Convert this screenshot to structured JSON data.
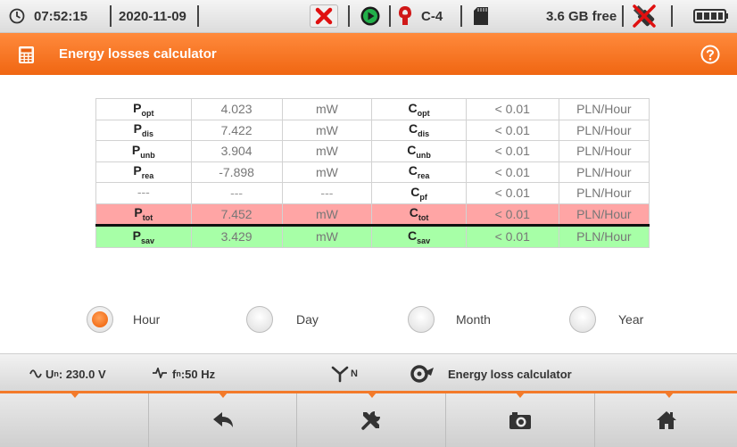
{
  "status": {
    "time": "07:52:15",
    "date": "2020-11-09",
    "clamp": "C-4",
    "storage": "3.6 GB free",
    "icons": [
      "clock-icon",
      "error-x-icon",
      "record-icon",
      "clamp-icon",
      "sd-card-icon",
      "usb-icon",
      "battery-icon"
    ]
  },
  "header": {
    "title": "Energy losses calculator",
    "icon": "calculator-icon",
    "help_icon": "help-icon"
  },
  "table": {
    "rows": [
      {
        "p_label": "P",
        "p_sub": "opt",
        "p_value": "4.023",
        "p_unit": "mW",
        "c_label": "C",
        "c_sub": "opt",
        "c_value": "< 0.01",
        "c_unit": "PLN/Hour"
      },
      {
        "p_label": "P",
        "p_sub": "dis",
        "p_value": "7.422",
        "p_unit": "mW",
        "c_label": "C",
        "c_sub": "dis",
        "c_value": "< 0.01",
        "c_unit": "PLN/Hour"
      },
      {
        "p_label": "P",
        "p_sub": "unb",
        "p_value": "3.904",
        "p_unit": "mW",
        "c_label": "C",
        "c_sub": "unb",
        "c_value": "< 0.01",
        "c_unit": "PLN/Hour"
      },
      {
        "p_label": "P",
        "p_sub": "rea",
        "p_value": "-7.898",
        "p_unit": "mW",
        "c_label": "C",
        "c_sub": "rea",
        "c_value": "< 0.01",
        "c_unit": "PLN/Hour"
      },
      {
        "p_label": "---",
        "p_sub": "",
        "p_value": "---",
        "p_unit": "---",
        "c_label": "C",
        "c_sub": "pf",
        "c_value": "< 0.01",
        "c_unit": "PLN/Hour"
      },
      {
        "p_label": "P",
        "p_sub": "tot",
        "p_value": "7.452",
        "p_unit": "mW",
        "c_label": "C",
        "c_sub": "tot",
        "c_value": "< 0.01",
        "c_unit": "PLN/Hour"
      },
      {
        "p_label": "P",
        "p_sub": "sav",
        "p_value": "3.429",
        "p_unit": "mW",
        "c_label": "C",
        "c_sub": "sav",
        "c_value": "< 0.01",
        "c_unit": "PLN/Hour"
      }
    ]
  },
  "period": {
    "options": [
      "Hour",
      "Day",
      "Month",
      "Year"
    ],
    "selected": "Hour"
  },
  "infobar": {
    "voltage_prefix": "U",
    "voltage_sub": "n",
    "voltage_value": ": 230.0 V",
    "freq_prefix": "f",
    "freq_sub": "n",
    "freq_value": ":50 Hz",
    "system_sub": "N",
    "mode": "Energy loss calculator"
  },
  "toolbar": {
    "buttons": [
      "empty",
      "back-icon",
      "tools-icon",
      "camera-icon",
      "home-icon"
    ]
  },
  "colors": {
    "accent": "#f37a2a",
    "total_row": "#ffa5a5",
    "saving_row": "#a7ffa7"
  }
}
